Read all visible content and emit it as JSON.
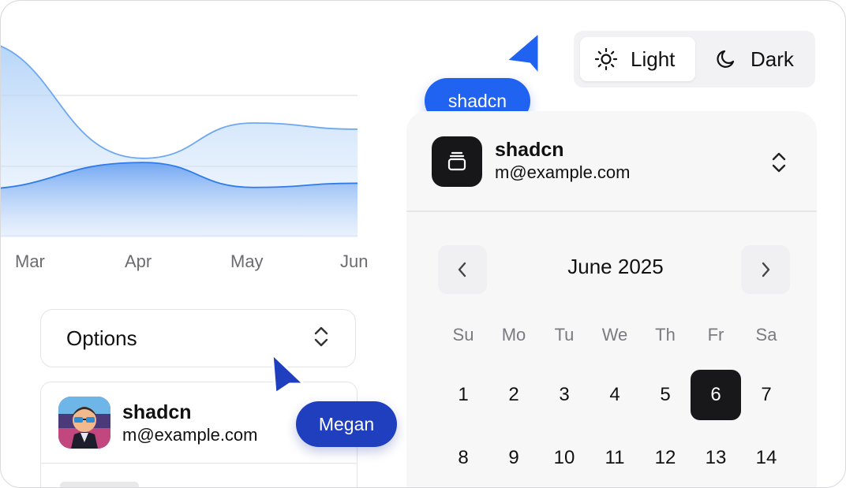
{
  "chart_data": {
    "type": "area",
    "categories": [
      "Mar",
      "Apr",
      "May",
      "Jun"
    ],
    "series": [
      {
        "values": [
          95,
          38,
          55,
          52
        ]
      },
      {
        "values": [
          23,
          36,
          24,
          26
        ]
      }
    ],
    "xlabel": "",
    "ylabel": "",
    "ylim": [
      0,
      110
    ],
    "grid": true,
    "colors": [
      "#6ea8f0",
      "#2f7bea"
    ]
  },
  "options": {
    "label": "Options"
  },
  "user": {
    "name": "shadcn",
    "email": "m@example.com"
  },
  "cursors": {
    "megan": "Megan",
    "shadcn": "shadcn"
  },
  "theme": {
    "light": "Light",
    "dark": "Dark",
    "selected": "Light"
  },
  "account": {
    "name": "shadcn",
    "email": "m@example.com"
  },
  "calendar": {
    "month": "June 2025",
    "weekdays": [
      "Su",
      "Mo",
      "Tu",
      "We",
      "Th",
      "Fr",
      "Sa"
    ],
    "weeks": [
      [
        "1",
        "2",
        "3",
        "4",
        "5",
        "6",
        "7"
      ],
      [
        "8",
        "9",
        "10",
        "11",
        "12",
        "13",
        "14"
      ]
    ],
    "selected": "6"
  },
  "colors": {
    "accent_blue": "#1f63f0",
    "megan_blue": "#1f3fbf",
    "selected_day": "#18181b"
  }
}
